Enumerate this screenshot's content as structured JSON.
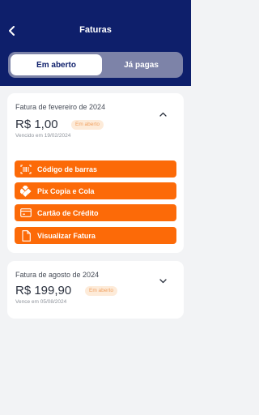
{
  "header": {
    "title": "Faturas",
    "back_icon": "chevron-left-icon",
    "background": "#0e1f6b"
  },
  "tabs": [
    {
      "label": "Em aberto",
      "active": true
    },
    {
      "label": "Já pagas",
      "active": false
    }
  ],
  "invoices": [
    {
      "title": "Fatura de fevereiro de 2024",
      "amount": "R$ 1,00",
      "status": "Em aberto",
      "due": "Vencido em 19/02/2024",
      "expanded": true,
      "chevron_icon": "chevron-up-icon",
      "actions": [
        {
          "label": "Código de barras",
          "icon": "barcode-icon"
        },
        {
          "label": "Pix Copia e Cola",
          "icon": "pix-icon"
        },
        {
          "label": "Cartão de Crédito",
          "icon": "credit-card-icon"
        },
        {
          "label": "Visualizar Fatura",
          "icon": "document-icon"
        }
      ]
    },
    {
      "title": "Fatura de agosto de 2024",
      "amount": "R$ 199,90",
      "status": "Em aberto",
      "due": "Vence em 05/08/2024",
      "expanded": false,
      "chevron_icon": "chevron-down-icon"
    }
  ],
  "colors": {
    "accent": "#fc6a08",
    "badge_bg": "#fdebd9",
    "badge_text": "#f0a060"
  }
}
